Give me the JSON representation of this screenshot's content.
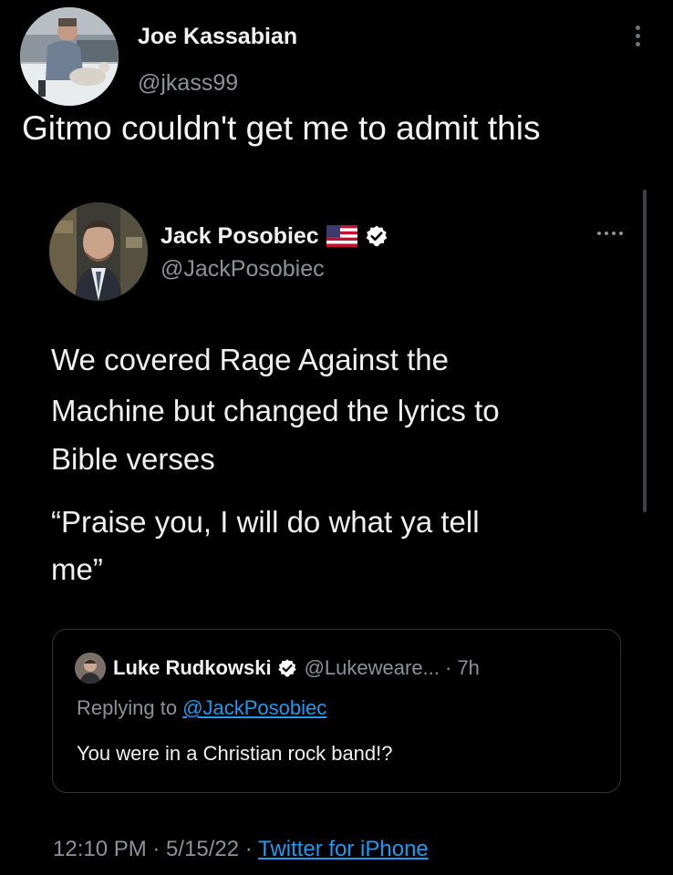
{
  "outer_tweet": {
    "author_name": "Joe Kassabian",
    "author_handle": "@jkass99",
    "text": "Gitmo couldn't get me to admit this",
    "more_icon": "more-vertical-icon"
  },
  "quoted_tweet": {
    "author_name": "Jack Posobiec",
    "author_handle": "@JackPosobiec",
    "flag_icon": "us-flag-icon",
    "verified_icon": "verified-badge-icon",
    "more_icon": "more-horizontal-icon",
    "text_lines": [
      "We covered Rage Against the",
      "Machine but changed the lyrics to",
      "Bible verses",
      "“Praise you, I will do what ya tell",
      "me”"
    ]
  },
  "reply": {
    "author_name": "Luke Rudkowski",
    "verified_icon": "verified-badge-icon",
    "handle_time": "@Lukeweare... · 7h",
    "replying_prefix": "Replying to ",
    "replying_to": "@JackPosobiec",
    "text": "You were in a Christian rock band!?"
  },
  "footer": {
    "timestamp": "12:10 PM · 5/15/22 · ",
    "source": "Twitter for iPhone"
  },
  "colors": {
    "background": "#000000",
    "text_primary": "#e7e9ea",
    "text_secondary": "#8b9298",
    "link": "#1d9bf0",
    "border": "#2f3336"
  }
}
